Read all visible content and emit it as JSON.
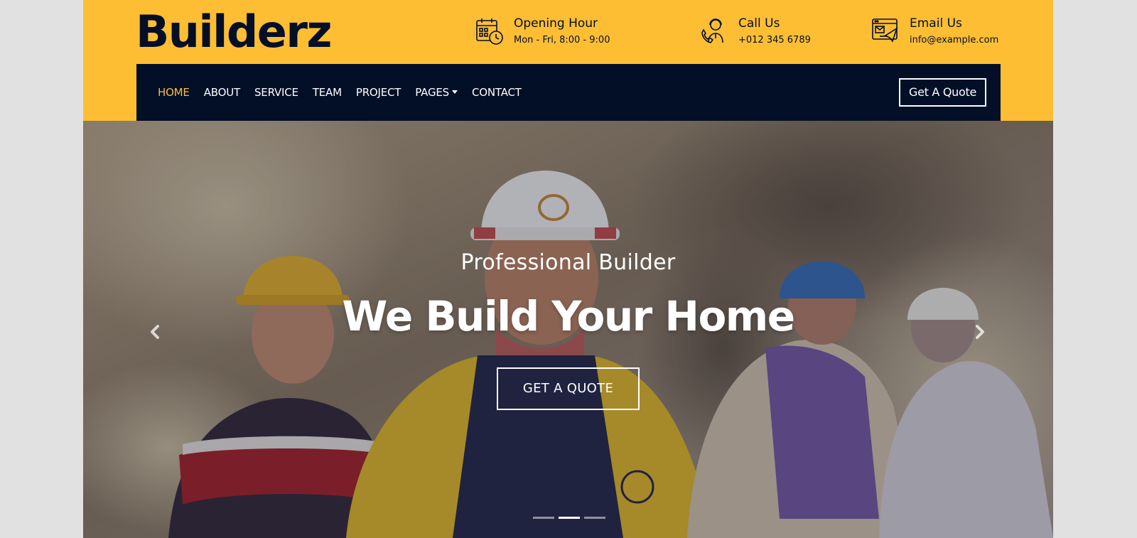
{
  "brand": {
    "name": "Builderz"
  },
  "colors": {
    "accent": "#fdbe33",
    "dark": "#030f27",
    "outer_bg": "#e1e1e1"
  },
  "header_info": {
    "opening": {
      "icon": "calendar-clock-icon",
      "title": "Opening Hour",
      "text": "Mon - Fri, 8:00 - 9:00"
    },
    "call": {
      "icon": "support-agent-icon",
      "title": "Call Us",
      "text": "+012 345 6789"
    },
    "email": {
      "icon": "email-browser-icon",
      "title": "Email Us",
      "text": "info@example.com"
    }
  },
  "nav": {
    "items": [
      {
        "label": "HOME",
        "active": true
      },
      {
        "label": "ABOUT"
      },
      {
        "label": "SERVICE"
      },
      {
        "label": "TEAM"
      },
      {
        "label": "PROJECT"
      },
      {
        "label": "PAGES",
        "has_dropdown": true
      },
      {
        "label": "CONTACT"
      }
    ],
    "quote_button": "Get A Quote"
  },
  "hero": {
    "subtitle": "Professional Builder",
    "title": "We Build Your Home",
    "button": "GET A QUOTE",
    "slides": 3,
    "active_slide": 2,
    "prev_icon": "chevron-left-icon",
    "next_icon": "chevron-right-icon",
    "image": "construction-workers-photo"
  }
}
